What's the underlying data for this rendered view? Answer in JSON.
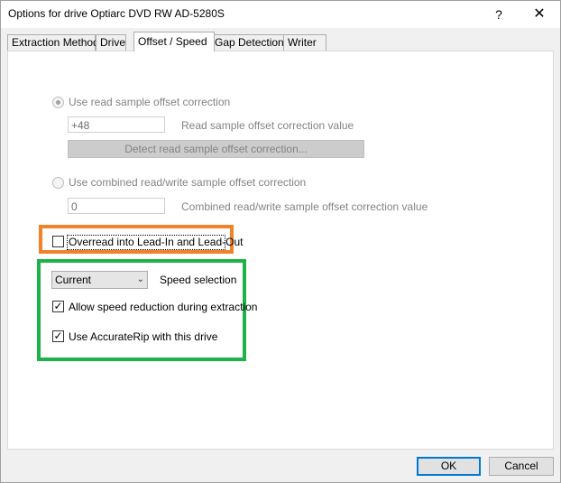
{
  "window": {
    "title": "Options for drive Optiarc DVD RW AD-5280S",
    "help_glyph": "?",
    "close_glyph": "✕"
  },
  "tabs": [
    {
      "label": "Extraction Method",
      "active": false
    },
    {
      "label": "Drive",
      "active": false
    },
    {
      "label": "Offset / Speed",
      "active": true
    },
    {
      "label": "Gap Detection",
      "active": false
    },
    {
      "label": "Writer",
      "active": false
    }
  ],
  "offset": {
    "read_offset_radio_label": "Use read sample offset correction",
    "read_offset_value": "+48",
    "read_offset_value_label": "Read sample offset correction value",
    "detect_button_label": "Detect read sample offset correction...",
    "combined_radio_label": "Use combined read/write sample offset correction",
    "combined_value": "0",
    "combined_value_label": "Combined read/write sample offset correction value",
    "read_offset_selected": true
  },
  "overread": {
    "label": "Overread into Lead-In and Lead-Out",
    "checked": false
  },
  "speed": {
    "selected": "Current",
    "label": "Speed selection",
    "allow_reduction_label": "Allow speed reduction during extraction",
    "allow_reduction_checked": true,
    "accuraterip_label": "Use AccurateRip with this drive",
    "accuraterip_checked": true
  },
  "buttons": {
    "ok": "OK",
    "cancel": "Cancel"
  },
  "colors": {
    "highlight_orange": "#f0822a",
    "highlight_green": "#1db34a",
    "default_button_border": "#0078d7"
  }
}
